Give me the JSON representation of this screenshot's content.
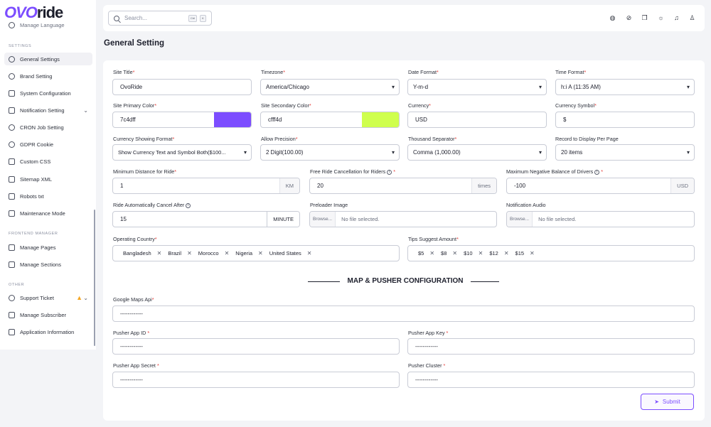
{
  "app": {
    "logo_text": "OVOride"
  },
  "sidebar": {
    "cut_item": "Manage Language",
    "section_settings": "SETTINGS",
    "section_frontend": "FRONTEND MANAGER",
    "section_other": "OTHER",
    "items": [
      {
        "label": "General Settings",
        "icon": "gear-icon",
        "active": true
      },
      {
        "label": "Brand Setting",
        "icon": "brand-icon"
      },
      {
        "label": "System Configuration",
        "icon": "tools-icon"
      },
      {
        "label": "Notification Setting",
        "icon": "bell-icon",
        "has_chevron": true
      },
      {
        "label": "CRON Job Setting",
        "icon": "clock-icon"
      },
      {
        "label": "GDPR Cookie",
        "icon": "cookie-icon"
      },
      {
        "label": "Custom CSS",
        "icon": "css-icon"
      },
      {
        "label": "Sitemap XML",
        "icon": "sitemap-icon"
      },
      {
        "label": "Robots txt",
        "icon": "robot-icon"
      },
      {
        "label": "Maintenance Mode",
        "icon": "maintenance-icon"
      },
      {
        "label": "Manage Pages",
        "icon": "pages-icon"
      },
      {
        "label": "Manage Sections",
        "icon": "sections-icon"
      },
      {
        "label": "Support Ticket",
        "icon": "ticket-icon",
        "has_warning": true,
        "has_chevron": true
      },
      {
        "label": "Manage Subscriber",
        "icon": "subscriber-icon"
      },
      {
        "label": "Application Information",
        "icon": "info-icon"
      }
    ]
  },
  "topbar": {
    "search_placeholder": "Search...",
    "kbd1": "Ctrl",
    "kbd2": "K",
    "icons": [
      "globe-icon",
      "link-icon",
      "copy-icon",
      "sun-icon",
      "bell-icon",
      "user-icon"
    ]
  },
  "page": {
    "title": "General Setting"
  },
  "form": {
    "site_title": {
      "label": "Site Title",
      "value": "OvoRide"
    },
    "timezone": {
      "label": "Timezone",
      "value": "America/Chicago"
    },
    "date_format": {
      "label": "Date Format",
      "value": "Y-m-d"
    },
    "time_format": {
      "label": "Time Format",
      "value": "h:i A (11:35 AM)"
    },
    "primary_color": {
      "label": "Site Primary Color",
      "value": "7c4dff",
      "swatch": "#7c4dff"
    },
    "secondary_color": {
      "label": "Site Secondary Color",
      "value": "cfff4d",
      "swatch": "#cfff4d"
    },
    "currency": {
      "label": "Currency",
      "value": "USD"
    },
    "currency_symbol": {
      "label": "Currency Symbol",
      "value": "$"
    },
    "currency_format": {
      "label": "Currency Showing Format",
      "value": "Show Currency Text and Symbol Both($100..."
    },
    "allow_precision": {
      "label": "Allow Precision",
      "value": "2 Digit(100.00)"
    },
    "thousand_separator": {
      "label": "Thousand Separator",
      "value": "Comma (1,000.00)"
    },
    "records_per_page": {
      "label": "Record to Display Per Page",
      "value": "20 items"
    },
    "min_distance": {
      "label": "Minimum Distance for Ride",
      "value": "1",
      "suffix": "KM"
    },
    "free_cancellation": {
      "label": "Free Ride Cancellation for Riders",
      "value": "20",
      "suffix": "times"
    },
    "max_negative_balance": {
      "label": "Maximum Negative Balance of Drivers",
      "value": "-100",
      "suffix": "USD"
    },
    "auto_cancel": {
      "label": "Ride Automatically Cancel After",
      "value": "15",
      "suffix": "MINUTE"
    },
    "preloader_image": {
      "label": "Preloader Image",
      "button": "Browse...",
      "status": "No file selected."
    },
    "notification_audio": {
      "label": "Notification Audio",
      "button": "Browse...",
      "status": "No file selected."
    },
    "operating_country": {
      "label": "Operating Country",
      "tags": [
        "Bangladesh",
        "Brazil",
        "Morocco",
        "Nigeria",
        "United States"
      ]
    },
    "tips_amount": {
      "label": "Tips Suggest Amount",
      "tags": [
        "$5",
        "$8",
        "$10",
        "$12",
        "$15"
      ]
    },
    "section_title": "MAP & PUSHER CONFIGURATION",
    "google_maps_api": {
      "label": "Google Maps Api",
      "value": "------------"
    },
    "pusher_app_id": {
      "label": "Pusher App ID",
      "value": "------------"
    },
    "pusher_app_key": {
      "label": "Pusher App Key",
      "value": "------------"
    },
    "pusher_app_secret": {
      "label": "Pusher App Secret",
      "value": "------------"
    },
    "pusher_cluster": {
      "label": "Pusher Cluster",
      "value": "------------"
    },
    "submit_label": "Submit"
  },
  "colors": {
    "accent": "#7c4dff",
    "secondary": "#cfff4d",
    "required": "#e53935",
    "warning": "#f5a623"
  }
}
